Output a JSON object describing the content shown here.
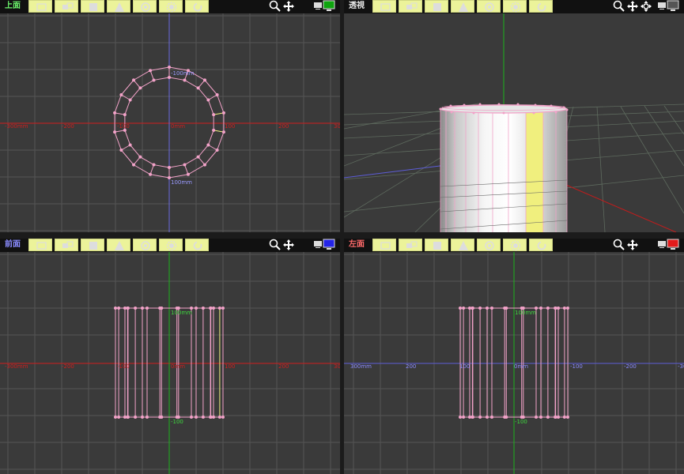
{
  "views": {
    "top": {
      "title": "上面",
      "title_color": "#6cf36c"
    },
    "persp": {
      "title": "透視",
      "title_color": "#e8e8e8"
    },
    "front": {
      "title": "前面",
      "title_color": "#8a8cff"
    },
    "left": {
      "title": "左面",
      "title_color": "#ff6a6a"
    }
  },
  "toolbar_icons": [
    "move-icon",
    "scale-icon",
    "select-icon",
    "shape-icon",
    "rotate-icon",
    "settings-icon",
    "refresh-icon"
  ],
  "axis_labels": {
    "top": {
      "x_neg300": "-300mm",
      "x_neg200": "-200",
      "x_neg100": "-100",
      "origin": "0mm",
      "x_100": "100",
      "x_200": "200",
      "x_300": "30",
      "y_neg100": "-100mm",
      "y_100": "100mm"
    },
    "front": {
      "x_neg300": "-300mm",
      "x_neg200": "-200",
      "x_neg100": "-100",
      "origin": "0mm",
      "x_100": "100",
      "x_200": "200",
      "x_300": "30",
      "y_100": "100mm",
      "y_neg100": "-100"
    },
    "left": {
      "x_300": "300mm",
      "x_200": "200",
      "x_100": "100",
      "origin": "0mm",
      "x_neg100": "-100",
      "x_neg200": "-200",
      "x_neg300": "-30",
      "y_100": "100mm",
      "y_neg100": "-100"
    }
  },
  "colors": {
    "x_axis": "#d01d1d",
    "y_axis_top": "#6a6adf",
    "y_axis_green": "#1cb21c",
    "mesh": "#f2a2c8",
    "highlight": "#f0ef7e",
    "grid": "#545454",
    "monitor_top": "#0ea40e",
    "monitor_front": "#2424e8",
    "monitor_left": "#e21b1b"
  }
}
